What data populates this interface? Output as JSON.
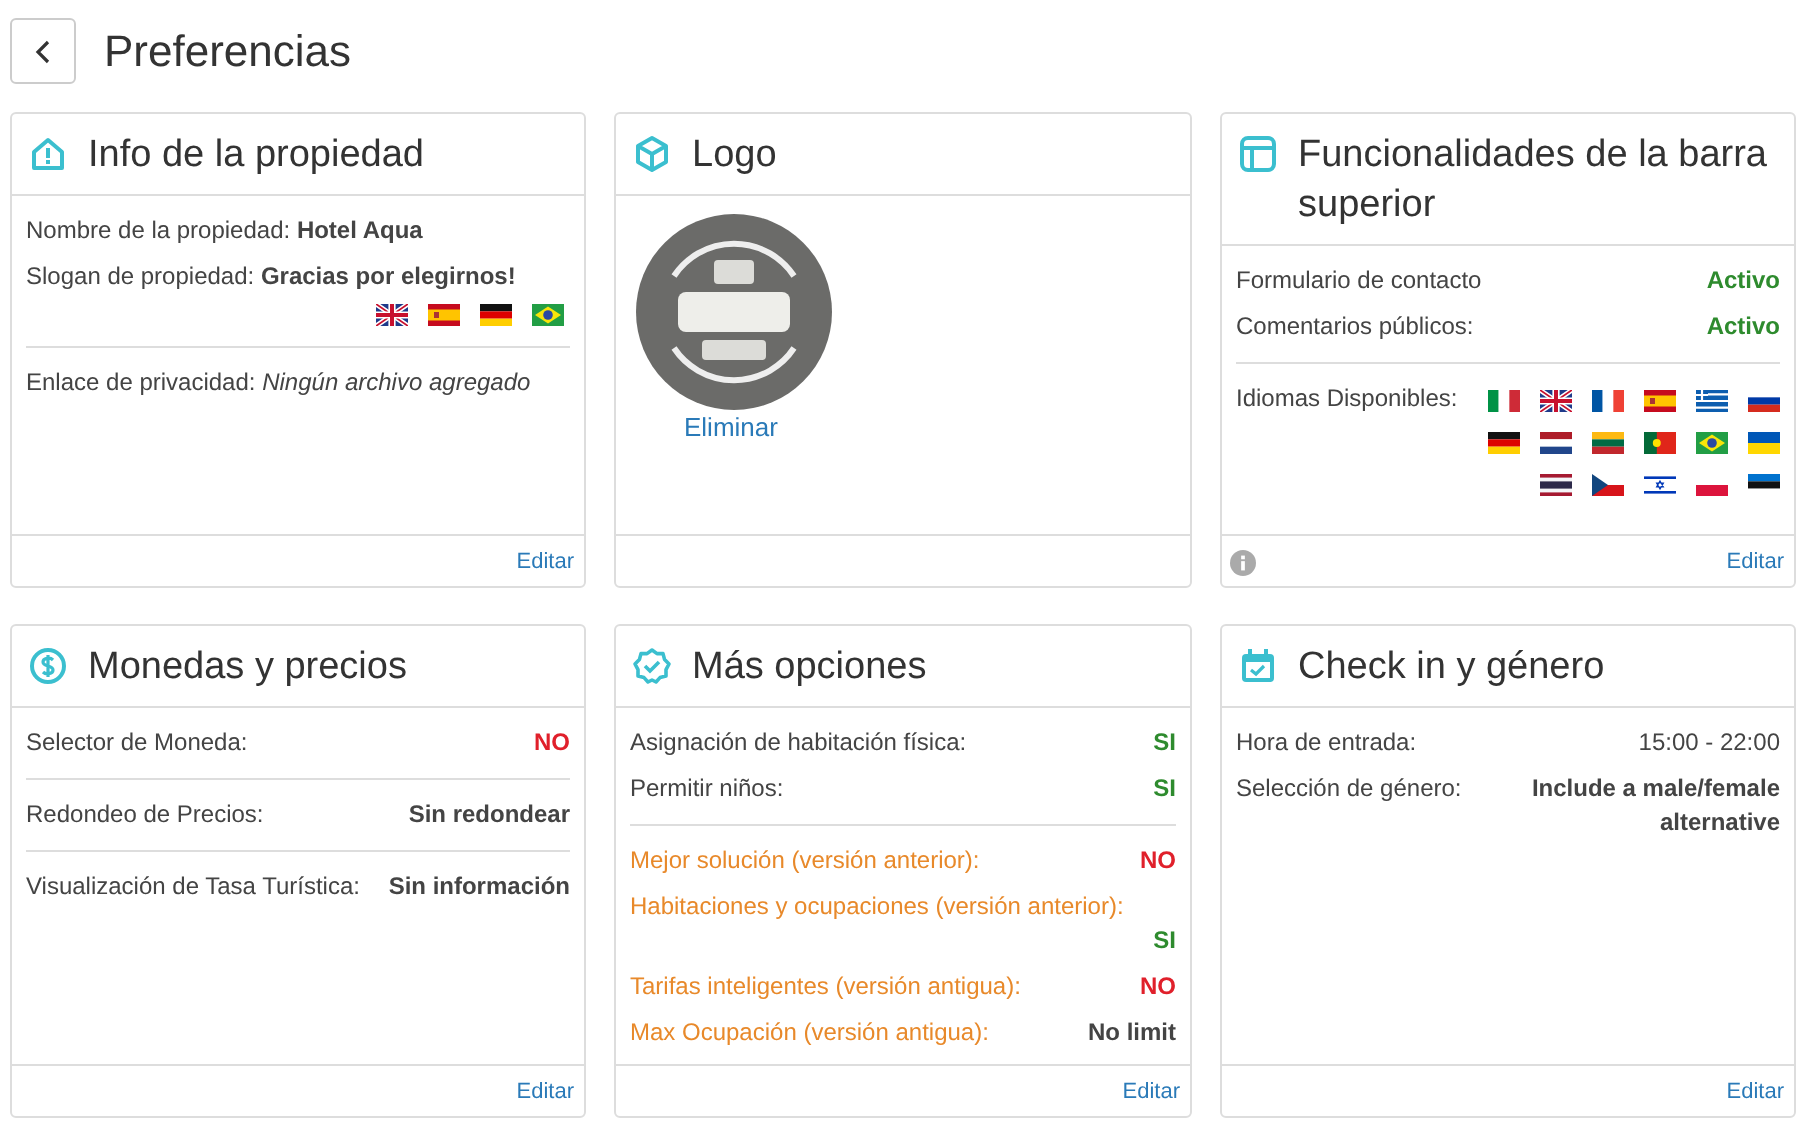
{
  "header": {
    "title": "Preferencias"
  },
  "cards": [
    {
      "kind": "fields",
      "title": "Info de la propiedad",
      "footer": {
        "link": "Editar"
      },
      "rows": [
        {
          "kind": "inline",
          "label": "Nombre de la propiedad:",
          "value": "Hotel Aqua",
          "bold": true,
          "italic": false,
          "divider_before": false
        },
        {
          "kind": "inline",
          "label": "Slogan de propiedad:",
          "value": "Gracias por elegirnos!",
          "bold": true,
          "italic": false,
          "divider_before": false
        },
        {
          "kind": "flags",
          "divider_before": false
        },
        {
          "kind": "inline",
          "label": "Enlace de privacidad:",
          "value": "Ningún archivo agregado",
          "bold": false,
          "italic": true,
          "divider_before": true
        }
      ]
    },
    {
      "kind": "logo",
      "title": "Logo",
      "link": "Eliminar"
    },
    {
      "kind": "fields",
      "title": "Funcionalidades de la barra superior",
      "footer": {
        "link": "Editar",
        "info": true
      },
      "rows": [
        {
          "kind": "split",
          "label": "Formulario de contacto",
          "value": "Activo",
          "color": "#2e8b2e",
          "bold": true,
          "divider_before": false
        },
        {
          "kind": "split",
          "label": "Comentarios públicos:",
          "value": "Activo",
          "color": "#2e8b2e",
          "bold": true,
          "divider_before": false
        },
        {
          "kind": "languages",
          "label": "Idiomas Disponibles:",
          "divider_before": true
        }
      ]
    },
    {
      "kind": "fields",
      "title": "Monedas y precios",
      "footer": {
        "link": "Editar"
      },
      "rows": [
        {
          "kind": "split",
          "label": "Selector de Moneda:",
          "value": "NO",
          "color": "#e0202b",
          "bold": true,
          "divider_before": false
        },
        {
          "kind": "split",
          "label": "Redondeo de Precios:",
          "value": "Sin redondear",
          "color": "#444444",
          "bold": true,
          "divider_before": true
        },
        {
          "kind": "split",
          "label": "Visualización de Tasa Turística:",
          "value": "Sin información",
          "color": "#444444",
          "bold": true,
          "divider_before": true
        }
      ]
    },
    {
      "kind": "fields",
      "title": "Más opciones",
      "footer": {
        "link": "Editar"
      },
      "rows": [
        {
          "kind": "split",
          "label": "Asignación de habitación física:",
          "value": "SI",
          "color": "#2e8b2e",
          "bold": true,
          "legacy": false,
          "divider_before": false
        },
        {
          "kind": "split",
          "label": "Permitir niños:",
          "value": "SI",
          "color": "#2e8b2e",
          "bold": true,
          "legacy": false,
          "divider_before": false
        },
        {
          "kind": "split",
          "label": "Mejor solución (versión anterior):",
          "value": "NO",
          "color": "#e0202b",
          "bold": true,
          "legacy": true,
          "divider_before": true
        },
        {
          "kind": "stacked",
          "label": "Habitaciones y ocupaciones (versión anterior):",
          "value": "SI",
          "color": "#2e8b2e",
          "bold": true,
          "legacy": true,
          "divider_before": false
        },
        {
          "kind": "split",
          "label": "Tarifas inteligentes (versión antigua):",
          "value": "NO",
          "color": "#e0202b",
          "bold": true,
          "legacy": true,
          "divider_before": false
        },
        {
          "kind": "split",
          "label": "Max Ocupación (versión antigua):",
          "value": "No limit",
          "color": "#444444",
          "bold": true,
          "legacy": true,
          "divider_before": false
        }
      ]
    },
    {
      "kind": "fields",
      "title": "Check in y género",
      "footer": {
        "link": "Editar"
      },
      "rows": [
        {
          "kind": "split",
          "label": "Hora de entrada:",
          "value": "15:00 - 22:00",
          "color": "#444444",
          "bold": false,
          "divider_before": false
        },
        {
          "kind": "split",
          "label": "Selección de género:",
          "value": "Include a male/female alternative",
          "color": "#444444",
          "bold": true,
          "divider_before": false
        }
      ]
    }
  ]
}
